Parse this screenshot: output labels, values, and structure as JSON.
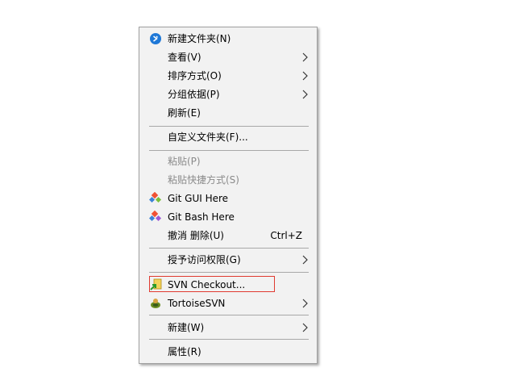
{
  "menu": {
    "items": [
      {
        "label": "新建文件夹(N)",
        "icon": "new-folder-icon",
        "submenu": false,
        "disabled": false
      },
      {
        "label": "查看(V)",
        "submenu": true,
        "disabled": false
      },
      {
        "label": "排序方式(O)",
        "submenu": true,
        "disabled": false
      },
      {
        "label": "分组依据(P)",
        "submenu": true,
        "disabled": false
      },
      {
        "label": "刷新(E)",
        "submenu": false,
        "disabled": false
      },
      {
        "label": "自定义文件夹(F)...",
        "submenu": false,
        "disabled": false
      },
      {
        "label": "粘贴(P)",
        "submenu": false,
        "disabled": true
      },
      {
        "label": "粘贴快捷方式(S)",
        "submenu": false,
        "disabled": true
      },
      {
        "label": "Git GUI Here",
        "icon": "git-gui-icon",
        "submenu": false,
        "disabled": false
      },
      {
        "label": "Git Bash Here",
        "icon": "git-bash-icon",
        "submenu": false,
        "disabled": false
      },
      {
        "label": "撤消 删除(U)",
        "shortcut": "Ctrl+Z",
        "submenu": false,
        "disabled": false
      },
      {
        "label": "授予访问权限(G)",
        "submenu": true,
        "disabled": false
      },
      {
        "label": "SVN Checkout...",
        "icon": "svn-checkout-icon",
        "submenu": false,
        "disabled": false,
        "highlighted": true
      },
      {
        "label": "TortoiseSVN",
        "icon": "tortoisesvn-icon",
        "submenu": true,
        "disabled": false
      },
      {
        "label": "新建(W)",
        "submenu": true,
        "disabled": false
      },
      {
        "label": "属性(R)",
        "submenu": false,
        "disabled": false
      }
    ]
  },
  "colors": {
    "menu_bg": "#f2f2f2",
    "disabled_text": "#8a8a8a",
    "highlight_border": "#e03a30",
    "git_orange": "#f05133",
    "git_blue": "#3b82d6"
  }
}
